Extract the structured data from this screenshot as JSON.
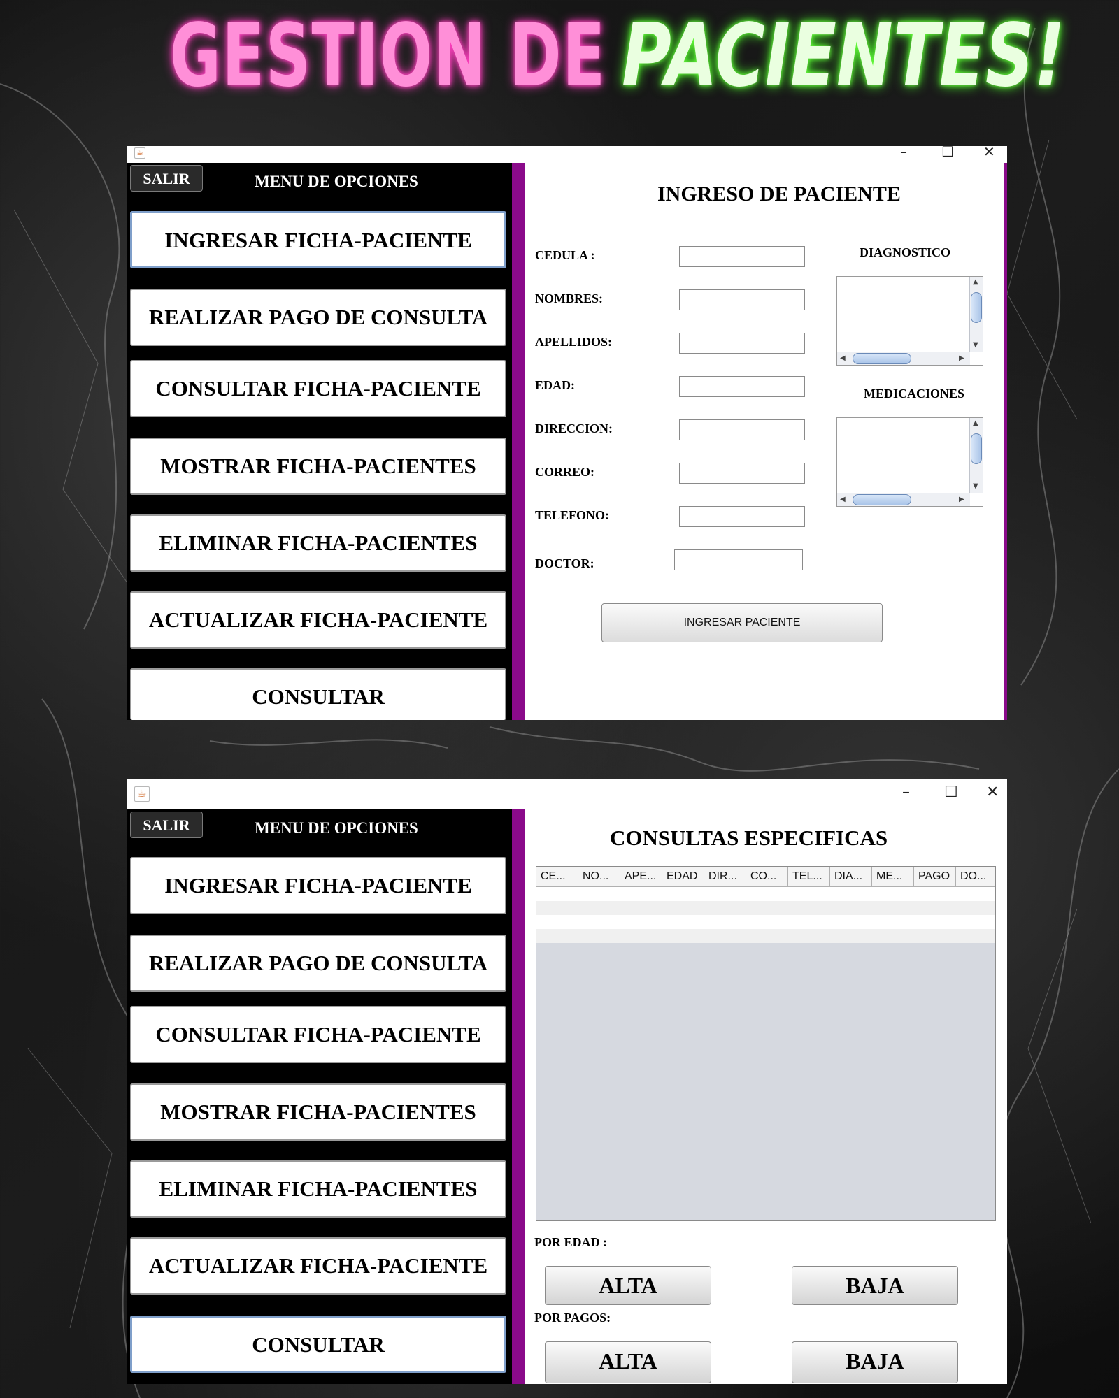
{
  "banner": {
    "part1": "GESTION DE",
    "part2": "PACIENTES!"
  },
  "window_controls": {
    "minimize": "–",
    "maximize": "☐",
    "close": "✕"
  },
  "menu": {
    "exit_label": "SALIR",
    "title": "MENU DE OPCIONES",
    "items": [
      "INGRESAR FICHA-PACIENTE",
      "REALIZAR PAGO DE CONSULTA",
      "CONSULTAR FICHA-PACIENTE",
      "MOSTRAR FICHA-PACIENTES",
      "ELIMINAR FICHA-PACIENTES",
      "ACTUALIZAR FICHA-PACIENTE",
      "CONSULTAR"
    ]
  },
  "ingreso": {
    "heading": "INGRESO DE PACIENTE",
    "fields": {
      "cedula": "CEDULA :",
      "nombres": "NOMBRES:",
      "apellidos": "APELLIDOS:",
      "edad": "EDAD:",
      "direccion": "DIRECCION:",
      "correo": "CORREO:",
      "telefono": "TELEFONO:",
      "doctor": "DOCTOR:"
    },
    "diagnostico_label": "DIAGNOSTICO",
    "medicaciones_label": "MEDICACIONES",
    "submit_label": "INGRESAR PACIENTE"
  },
  "consultas": {
    "heading": "CONSULTAS ESPECIFICAS",
    "columns": [
      "CE...",
      "NO...",
      "APE...",
      "EDAD",
      "DIR...",
      "CO...",
      "TEL...",
      "DIA...",
      "ME...",
      "PAGO",
      "DO..."
    ],
    "por_edad_label": "POR EDAD :",
    "por_pagos_label": "POR PAGOS:",
    "alta_label": "ALTA",
    "baja_label": "BAJA"
  },
  "colors": {
    "accent_purple": "#8a0a8a",
    "neon_pink": "#ff8fd8",
    "neon_green": "#eaffe0",
    "selected_border": "#7f9fca"
  }
}
